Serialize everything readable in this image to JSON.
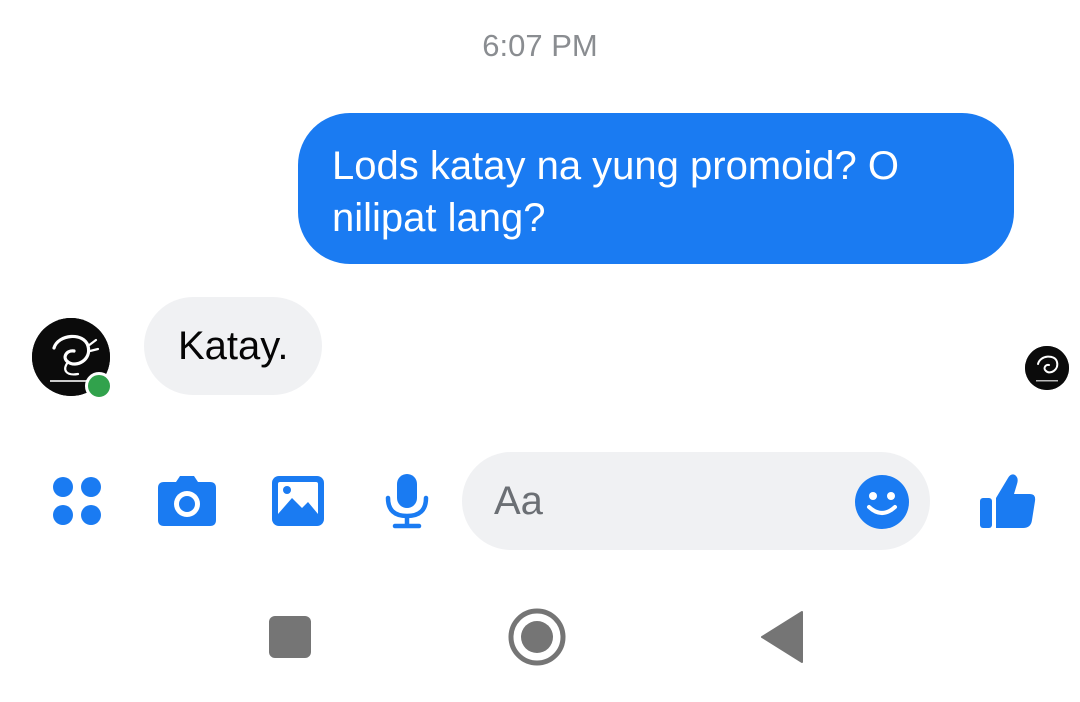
{
  "conversation": {
    "timestamp": "6:07 PM",
    "messages": [
      {
        "direction": "outgoing",
        "text": "Lods katay na yung promoid? O nilipat lang?"
      },
      {
        "direction": "incoming",
        "text": "Katay."
      }
    ],
    "contact": {
      "online": true
    }
  },
  "composer": {
    "placeholder": "Aa",
    "value": ""
  },
  "icons": {
    "menu": "four-dots-grid-icon",
    "camera": "camera-icon",
    "gallery": "image-icon",
    "microphone": "microphone-icon",
    "emoji": "smiley-icon",
    "like": "thumbs-up-icon",
    "recents": "square-icon",
    "home": "circle-icon",
    "back": "triangle-back-icon"
  },
  "colors": {
    "accent": "#1a7bf2",
    "incoming_bubble": "#f0f1f3",
    "online": "#31a24c",
    "timestamp_text": "#8a8d91",
    "nav_icons": "#757575"
  }
}
